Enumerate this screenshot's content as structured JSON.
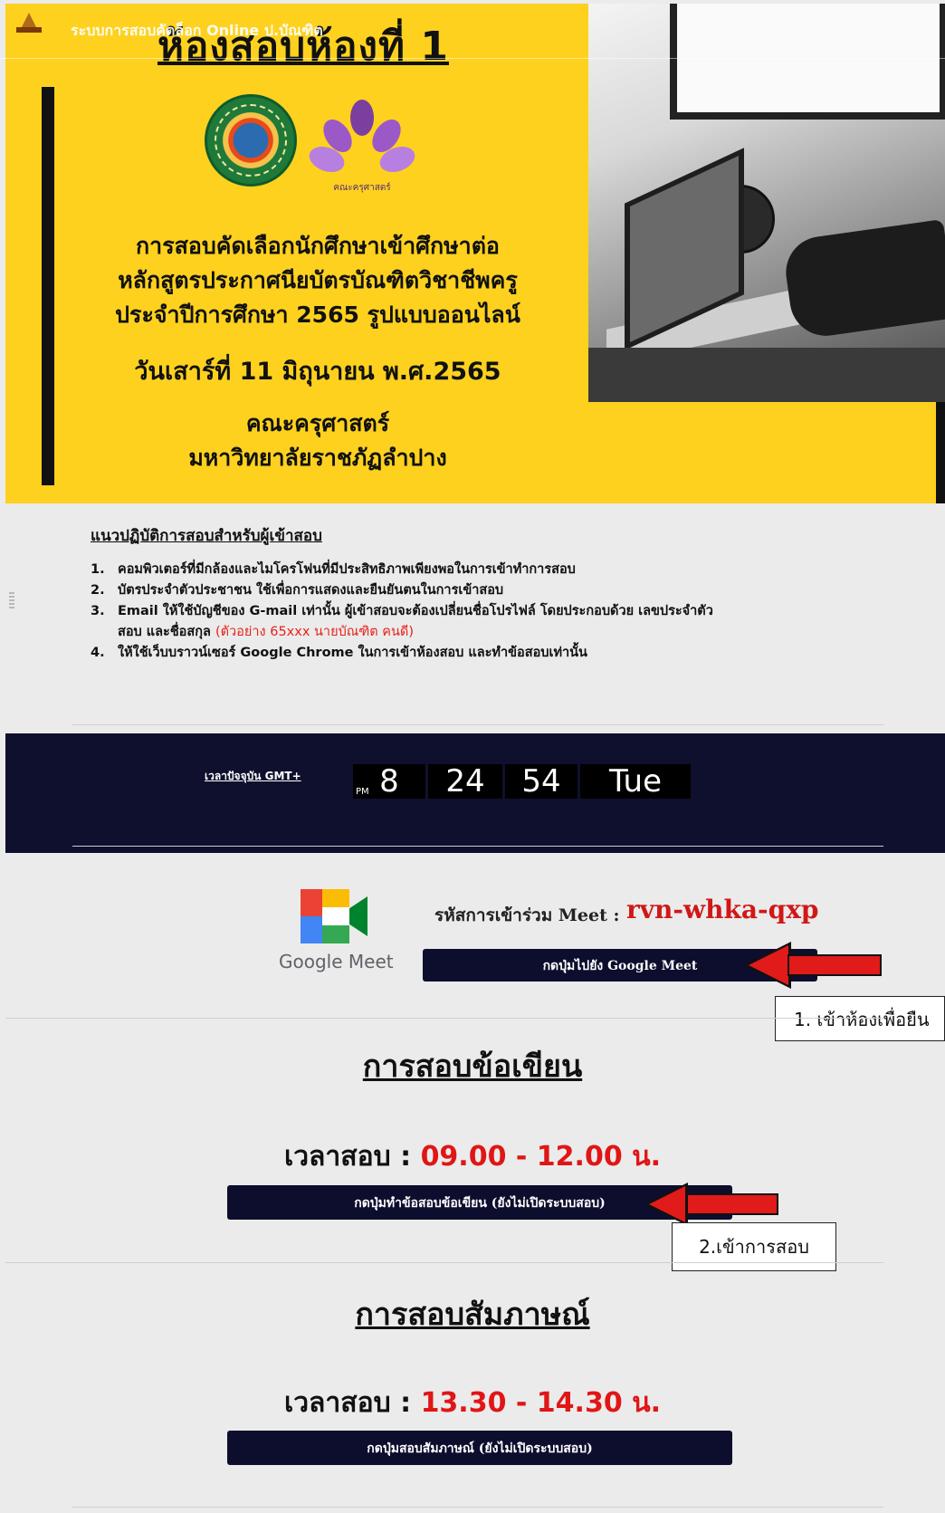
{
  "nav": {
    "title": "ระบบการสอบคัดล็อก Online ป.บัณฑิต"
  },
  "banner": {
    "title": "ห้องสอบห้องที่ 1",
    "logo2_caption": "คณะครุศาสตร์",
    "lines": [
      "การสอบคัดเลือกนักศึกษาเข้าศึกษาต่อ",
      "หลักสูตรประกาศนียบัตรบัณฑิตวิชาชีพครู",
      "ประจำปีการศึกษา 2565 รูปแบบออนไลน์",
      "วันเสาร์ที่ 11 มิถุนายน พ.ศ.2565",
      "คณะครุศาสตร์",
      "มหาวิทยาลัยราชภัฏลำปาง"
    ]
  },
  "guide": {
    "title": "แนวปฏิบัติการสอบสำหรับผู้เข้าสอบ",
    "items": [
      {
        "num": "1.",
        "text": "คอมพิวเตอร์ที่มีกล้องและไมโครโฟนที่มีประสิทธิภาพเพียงพอในการเข้าทำการสอบ"
      },
      {
        "num": "2.",
        "text": "บัตรประจำตัวประชาชน ใช้เพื่อการแสดงและยืนยันตนในการเข้าสอบ"
      },
      {
        "num": "3.",
        "text": "Email ให้ใช้บัญชีของ G-mail เท่านั้น ผู้เข้าสอบจะต้องเปลี่ยนชื่อโปรไฟล์ โดยประกอบด้วย เลขประจำตัวสอบ และชื่อสกุล",
        "note": "(ตัวอย่าง 65xxx นายบัณฑิต คนดี)"
      },
      {
        "num": "4.",
        "text": "ให้ใช้เว็บบราวน์เซอร์ Google Chrome ในการเข้าห้องสอบ และทำข้อสอบเท่านั้น"
      }
    ]
  },
  "clock": {
    "label": "เวลาปัจจุบัน GMT+",
    "ampm": "PM",
    "hour": "8",
    "minute": "24",
    "second": "54",
    "day": "Tue"
  },
  "meet": {
    "brand": "Google Meet",
    "code_label": "รหัสการเข้าร่วม Meet :",
    "code": "rvn-whka-qxp",
    "button": "กดปุ่มไปยัง Google Meet",
    "callout": "1. เข้าห้องเพื่อยืน"
  },
  "written": {
    "title": "การสอบข้อเขียน",
    "time_label": "เวลาสอบ :",
    "time": "09.00 - 12.00 น.",
    "button": "กดปุ่มทำข้อสอบข้อเขียน (ยังไม่เปิดระบบสอบ)",
    "callout": "2.เข้าการสอบ"
  },
  "interview": {
    "title": "การสอบสัมภาษณ์",
    "time_label": "เวลาสอบ :",
    "time": "13.30 - 14.30 น.",
    "button": "กดปุ่มสอบสัมภาษณ์ (ยังไม่เปิดระบบสอบ)"
  },
  "colors": {
    "banner_yellow": "#fdd11e",
    "navy": "#0d0d2e",
    "accent_red": "#e01616"
  }
}
